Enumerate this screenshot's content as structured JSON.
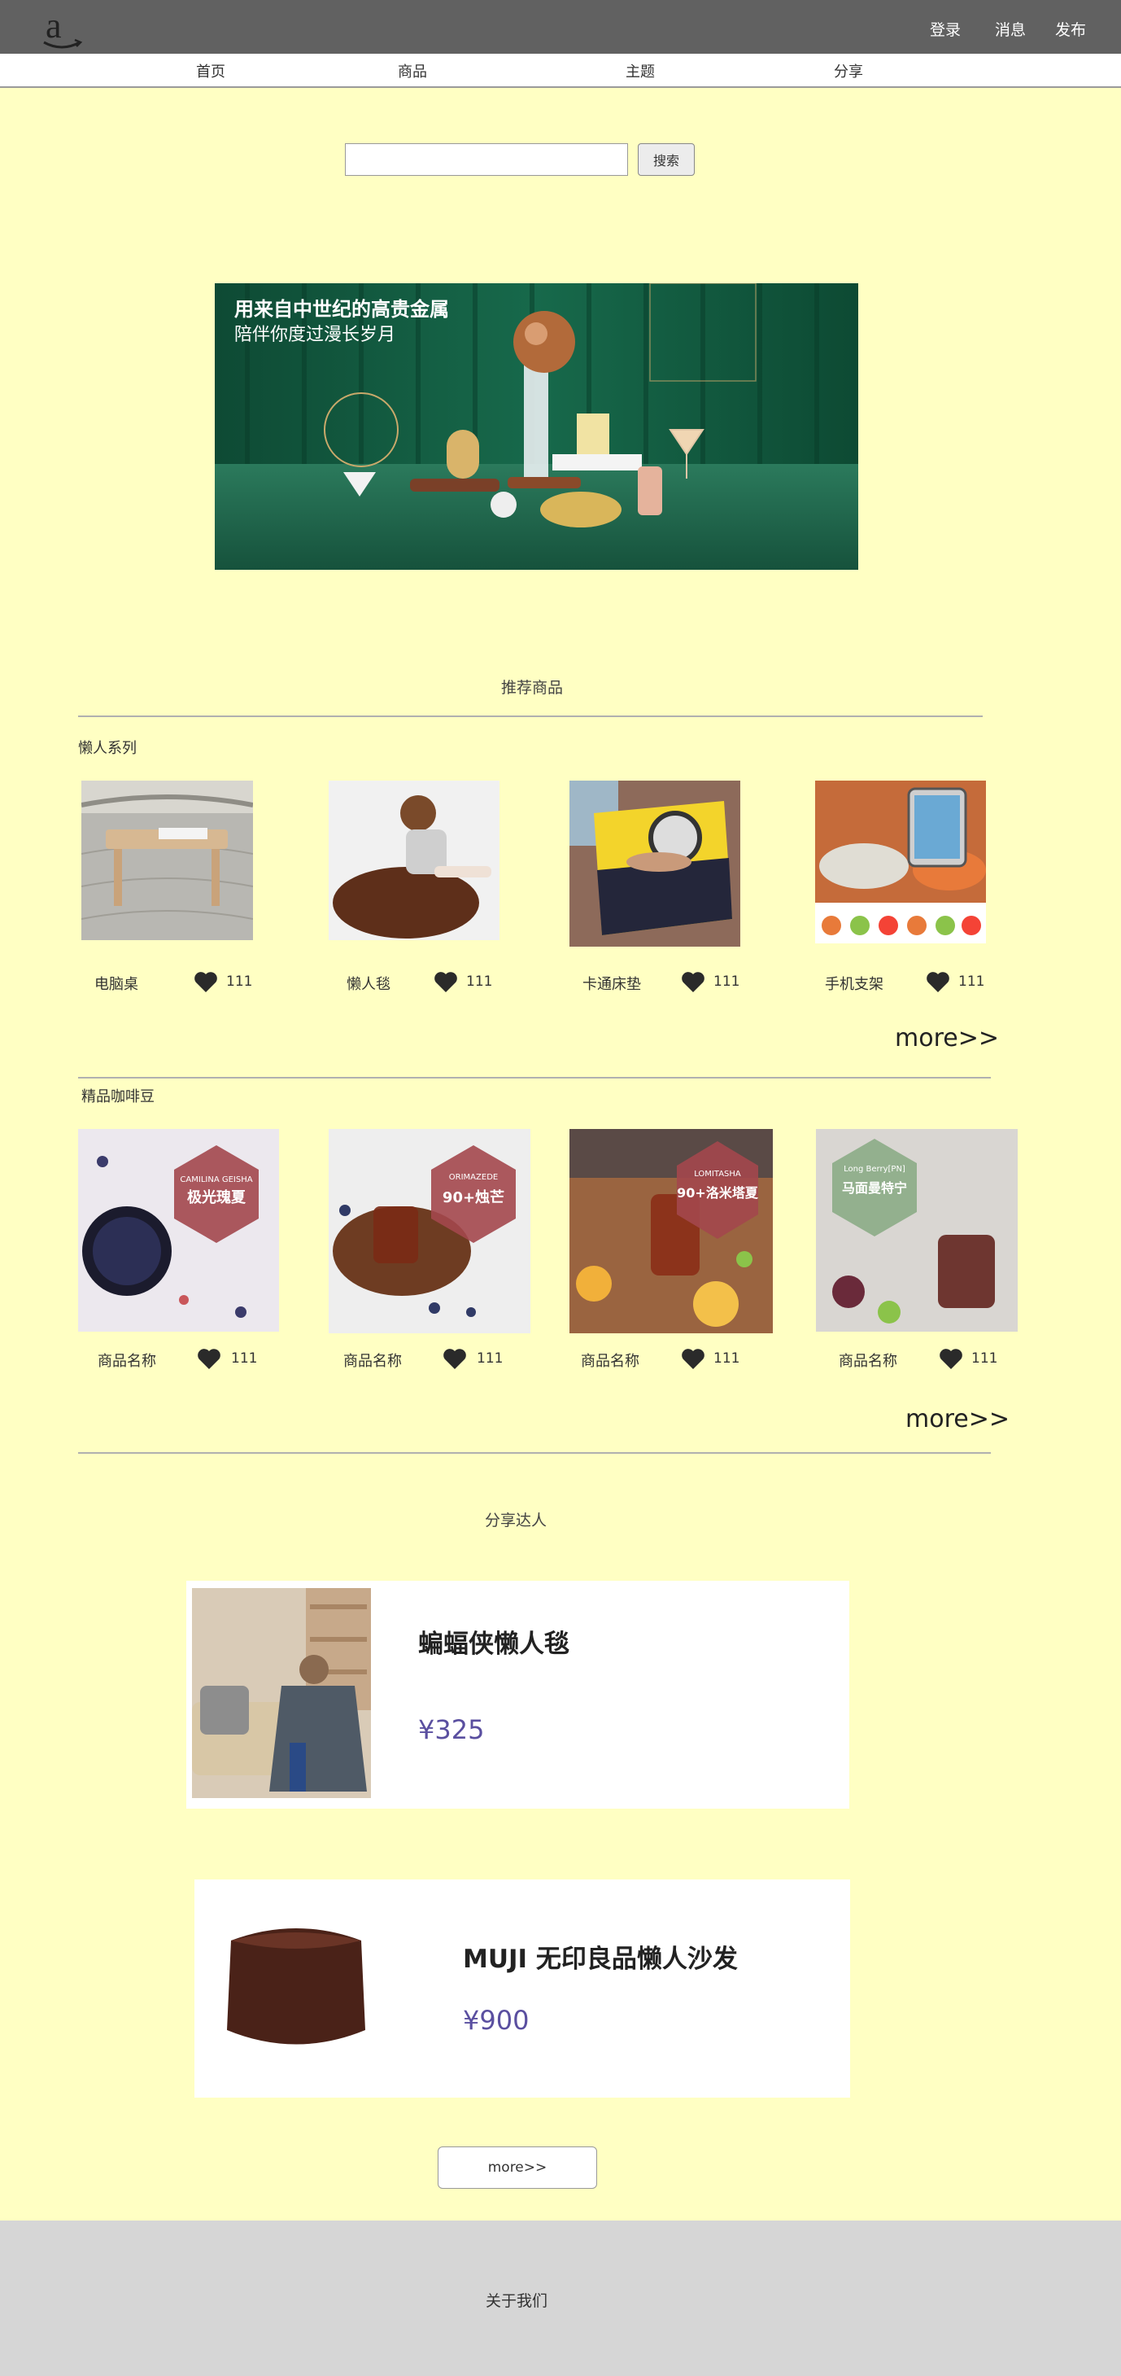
{
  "header": {
    "links": [
      "登录",
      "消息",
      "发布"
    ]
  },
  "nav": {
    "items": [
      "首页",
      "商品",
      "主题",
      "分享"
    ]
  },
  "search": {
    "placeholder": "",
    "button_label": "搜索"
  },
  "banner": {
    "headline": "用来自中世纪的高贵金属",
    "subline": "陪伴你度过漫长岁月"
  },
  "recommended": {
    "title": "推荐商品",
    "categories": [
      {
        "label": "懒人系列",
        "products": [
          {
            "name": "电脑桌",
            "likes": "111"
          },
          {
            "name": "懒人毯",
            "likes": "111"
          },
          {
            "name": "卡通床垫",
            "likes": "111"
          },
          {
            "name": "手机支架",
            "likes": "111"
          }
        ],
        "more": "more>>"
      },
      {
        "label": "精品咖啡豆",
        "products": [
          {
            "name": "商品名称",
            "likes": "111",
            "badge_en": "CAMILINA GEISHA",
            "badge_cn": "极光瑰夏"
          },
          {
            "name": "商品名称",
            "likes": "111",
            "badge_en": "ORIMAZEDE",
            "badge_cn": "90+烛芒"
          },
          {
            "name": "商品名称",
            "likes": "111",
            "badge_en": "LOMITASHA",
            "badge_cn": "90+洛米塔夏"
          },
          {
            "name": "商品名称",
            "likes": "111",
            "badge_en": "Long Berry[PN]",
            "badge_cn": "马面曼特宁"
          }
        ],
        "more": "more>>"
      }
    ]
  },
  "share": {
    "title": "分享达人",
    "items": [
      {
        "title": "蝙蝠侠懒人毯",
        "price": "¥325"
      },
      {
        "title": "MUJI 无印良品懒人沙发",
        "price": "¥900"
      }
    ],
    "more_button": "more>>"
  },
  "footer": {
    "about": "关于我们"
  },
  "colors": {
    "page_bg": "#ffffc3",
    "topbar_bg": "#616161",
    "footer_bg": "#d6d6d6",
    "price": "#5a4fa0"
  }
}
